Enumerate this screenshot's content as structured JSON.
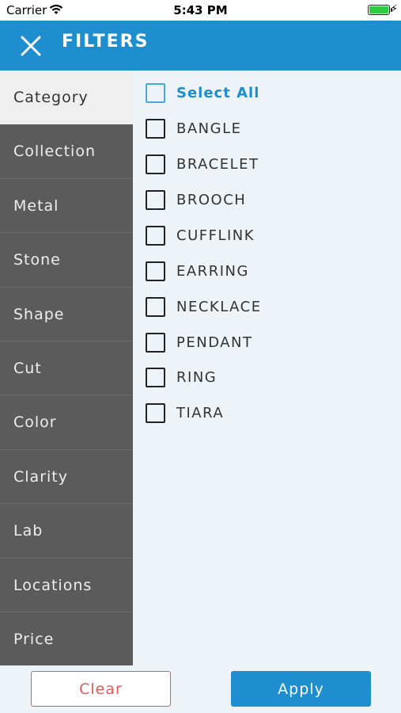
{
  "status_bar": {
    "carrier": "Carrier",
    "time": "5:43 PM",
    "wifi_icon": "wifi-icon",
    "battery_icon": "battery-icon",
    "charging_icon": "charging-bolt-icon"
  },
  "header": {
    "title": "FILTERS",
    "close_icon": "close-icon",
    "background_color": "#1e8ecf"
  },
  "sidebar": {
    "items": [
      {
        "label": "Category",
        "active": true
      },
      {
        "label": "Collection",
        "active": false
      },
      {
        "label": "Metal",
        "active": false
      },
      {
        "label": "Stone",
        "active": false
      },
      {
        "label": "Shape",
        "active": false
      },
      {
        "label": "Cut",
        "active": false
      },
      {
        "label": "Color",
        "active": false
      },
      {
        "label": "Clarity",
        "active": false
      },
      {
        "label": "Lab",
        "active": false
      },
      {
        "label": "Locations",
        "active": false
      },
      {
        "label": "Price",
        "active": false
      }
    ]
  },
  "options": {
    "select_all_label": "Select All",
    "items": [
      {
        "label": "BANGLE",
        "checked": false
      },
      {
        "label": "BRACELET",
        "checked": false
      },
      {
        "label": "BROOCH",
        "checked": false
      },
      {
        "label": "CUFFLINK",
        "checked": false
      },
      {
        "label": "EARRING",
        "checked": false
      },
      {
        "label": "NECKLACE",
        "checked": false
      },
      {
        "label": "PENDANT",
        "checked": false
      },
      {
        "label": "RING",
        "checked": false
      },
      {
        "label": "TIARA",
        "checked": false
      }
    ]
  },
  "footer": {
    "clear_label": "Clear",
    "apply_label": "Apply",
    "clear_color": "#e05a5a",
    "apply_color": "#1e8ecf"
  }
}
